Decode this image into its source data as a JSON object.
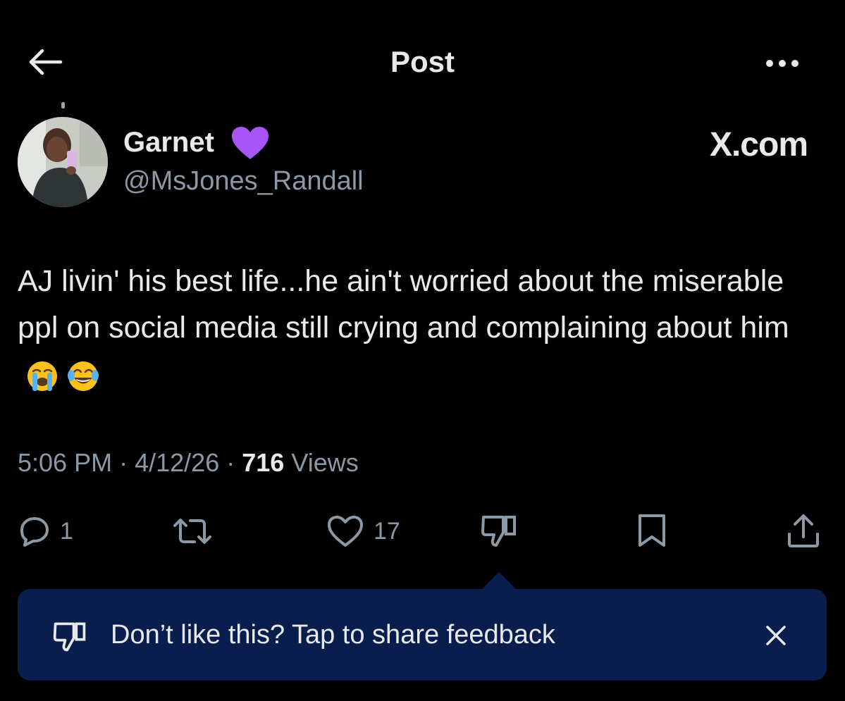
{
  "header": {
    "title": "Post",
    "back_icon": "arrow-left-icon",
    "more_icon": "more-horizontal-icon"
  },
  "author": {
    "name": "Garnet",
    "badge_icon": "purple-heart-icon",
    "handle": "@MsJones_Randall",
    "brand": "X.com"
  },
  "post": {
    "text": "AJ livin' his best life...he ain't worried about the miserable ppl on social media still crying and complaining about him",
    "emojis": [
      "loudly-crying-face-icon",
      "face-with-tears-of-joy-icon"
    ]
  },
  "meta": {
    "time": "5:06 PM",
    "separator": "·",
    "date": "4/12/26",
    "views_count": "716",
    "views_label": "Views"
  },
  "actions": {
    "reply_count": "1",
    "repost_count": "",
    "like_count": "17"
  },
  "feedback_banner": {
    "text": "Don’t like this? Tap to share feedback",
    "icon": "thumbs-down-icon",
    "close_icon": "close-icon"
  },
  "colors": {
    "background": "#000000",
    "text_primary": "#e7e9ea",
    "text_secondary": "#8b98a5",
    "banner_bg": "#0a1e4e",
    "heart": "#a855f7"
  }
}
